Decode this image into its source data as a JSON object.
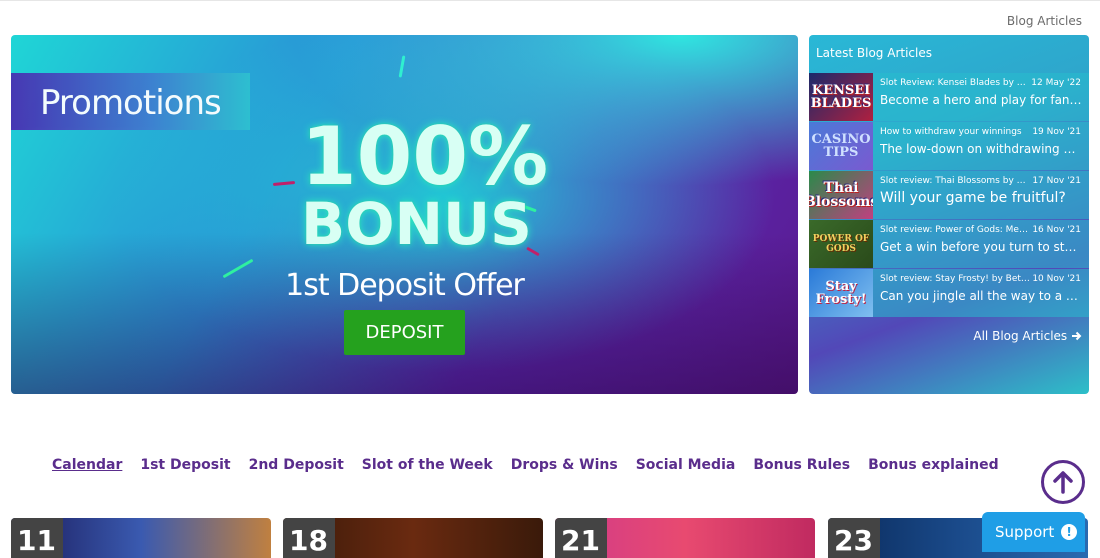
{
  "header": {
    "breadcrumb": "Blog Articles"
  },
  "hero": {
    "banner_title": "Promotions",
    "bonus_percent": "100%",
    "bonus_word": "BONUS",
    "offer_text": "1st Deposit Offer",
    "deposit_label": "DEPOSIT"
  },
  "blog": {
    "title": "Latest Blog Articles",
    "items": [
      {
        "thumb": "KENSEI BLADES",
        "sub": "Slot Review: Kensei Blades by Betso...",
        "date": "12 May '22",
        "headline": "Become a hero and play for fantas..."
      },
      {
        "thumb": "CASINO TIPS",
        "sub": "How to withdraw your winnings",
        "date": "19 Nov '21",
        "headline": "The low-down on withdrawing win..."
      },
      {
        "thumb": "Thai Blossoms",
        "sub": "Slot review: Thai Blossoms by Betso...",
        "date": "17 Nov '21",
        "headline": "Will your game be fruitful?"
      },
      {
        "thumb": "POWER OF GODS",
        "sub": "Slot review: Power of Gods: Medusa ...",
        "date": "16 Nov '21",
        "headline": "Get a win before you turn to stone!"
      },
      {
        "thumb": "Stay Frosty!",
        "sub": "Slot review: Stay Frosty! by Betsof...",
        "date": "10 Nov '21",
        "headline": "Can you jingle all the way to a win?"
      }
    ],
    "all_link": "All Blog Articles"
  },
  "tabs": [
    {
      "label": "Calendar",
      "active": true
    },
    {
      "label": "1st Deposit",
      "active": false
    },
    {
      "label": "2nd Deposit",
      "active": false
    },
    {
      "label": "Slot of the Week",
      "active": false
    },
    {
      "label": "Drops & Wins",
      "active": false
    },
    {
      "label": "Social Media",
      "active": false
    },
    {
      "label": "Bonus Rules",
      "active": false
    },
    {
      "label": "Bonus explained",
      "active": false
    }
  ],
  "calendar_cards": [
    {
      "day": "11"
    },
    {
      "day": "18"
    },
    {
      "day": "21"
    },
    {
      "day": "23"
    }
  ],
  "support": {
    "label": "Support"
  },
  "colors": {
    "accent": "#5a2d8c",
    "deposit_green": "#25a11e",
    "support_blue": "#1f9ee6"
  }
}
